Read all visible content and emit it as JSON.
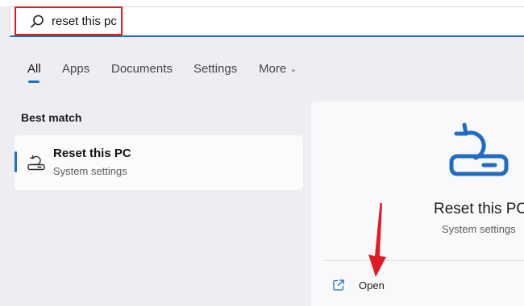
{
  "search": {
    "value": "reset this pc"
  },
  "tabs": [
    {
      "label": "All",
      "active": true
    },
    {
      "label": "Apps"
    },
    {
      "label": "Documents"
    },
    {
      "label": "Settings"
    },
    {
      "label": "More",
      "has_chevron": true
    }
  ],
  "best_match": {
    "heading": "Best match",
    "result": {
      "title": "Reset this PC",
      "subtitle": "System settings",
      "icon": "reset-pc-icon"
    }
  },
  "detail": {
    "title": "Reset this PC",
    "subtitle": "System settings",
    "icon": "reset-pc-icon",
    "actions": [
      {
        "label": "Open",
        "icon": "open-external-icon"
      }
    ]
  },
  "colors": {
    "accent": "#1f6cc4",
    "annotation_red": "#e01b24",
    "background": "#eeeef2"
  }
}
